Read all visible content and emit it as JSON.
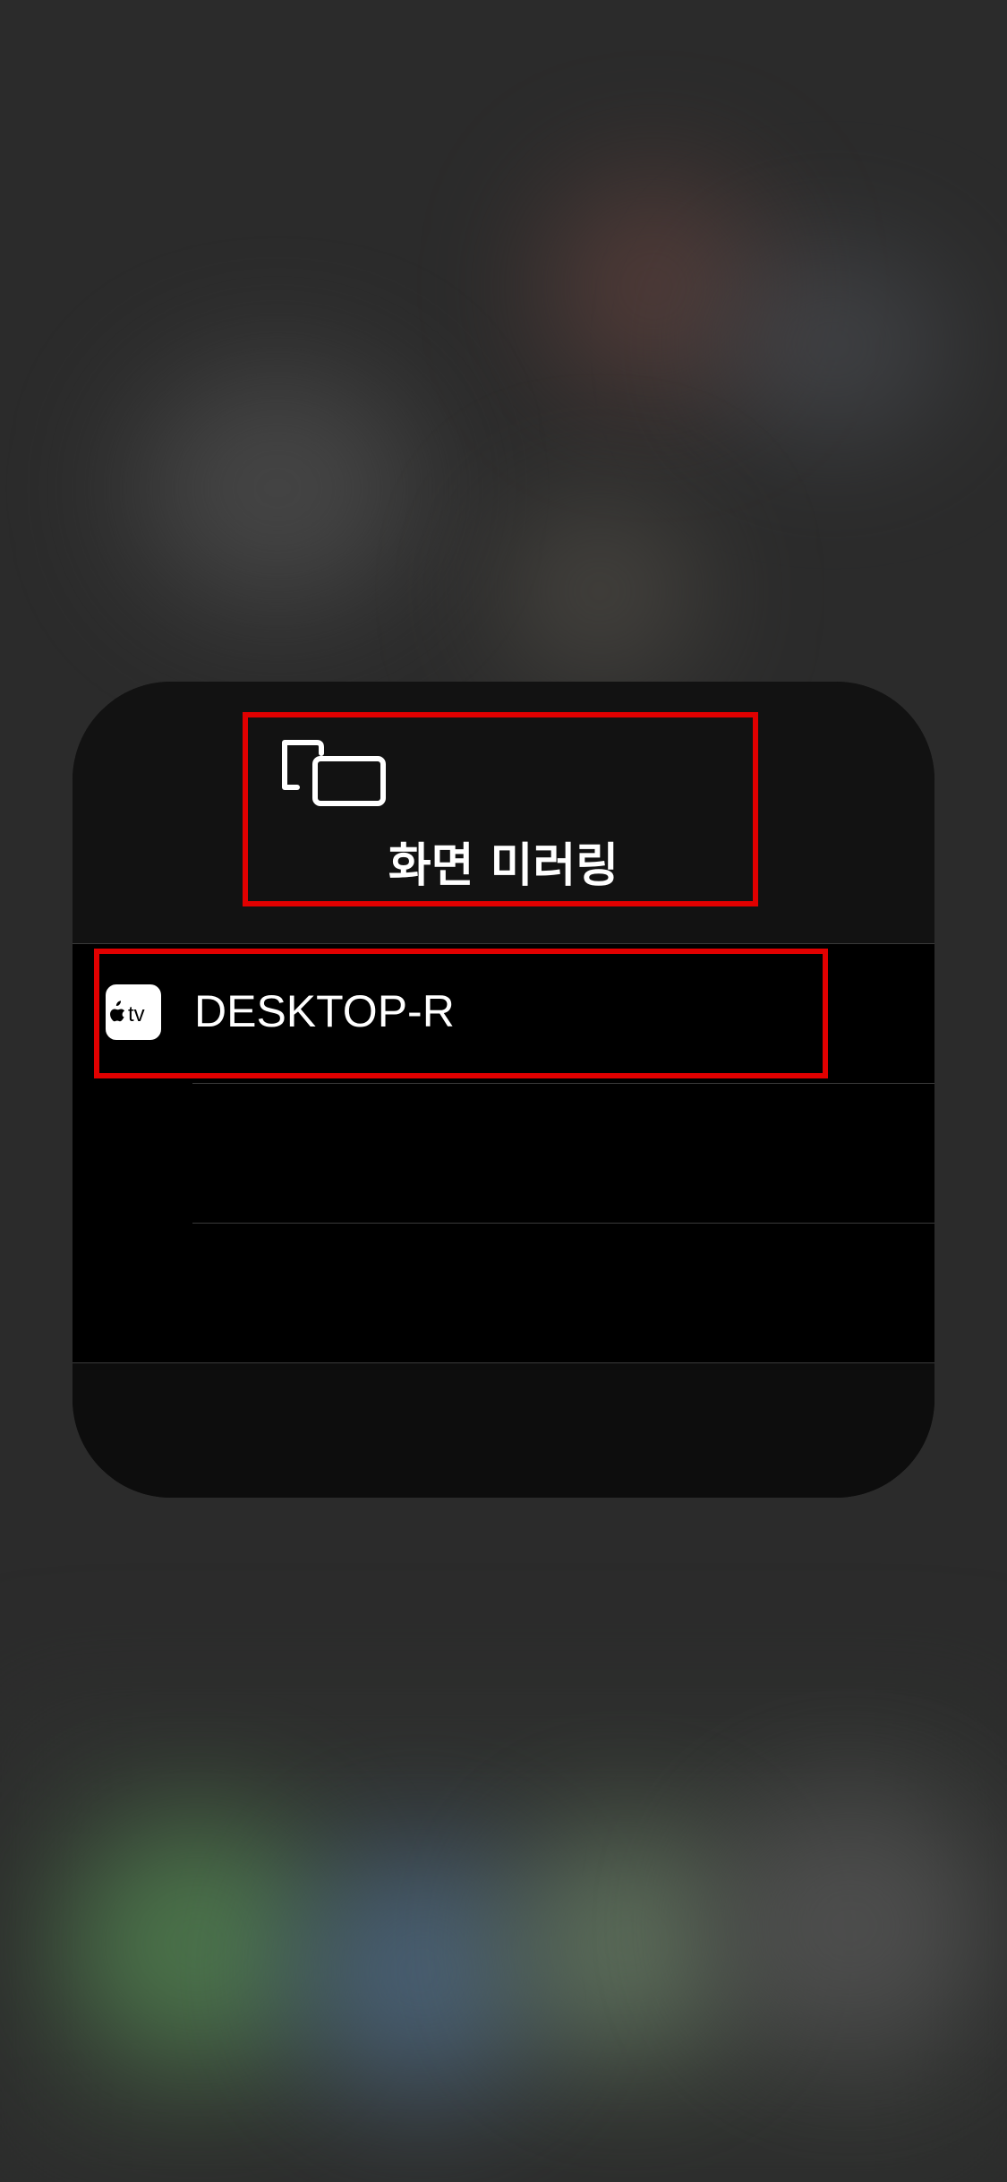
{
  "panel": {
    "title": "화면 미러링",
    "icon": "screen-mirroring-icon"
  },
  "devices": [
    {
      "label": "DESKTOP-R",
      "icon": "apple-tv-icon"
    }
  ],
  "colors": {
    "highlight": "#e10000",
    "panel_background": "#0d0d0d",
    "list_background": "#000000"
  }
}
